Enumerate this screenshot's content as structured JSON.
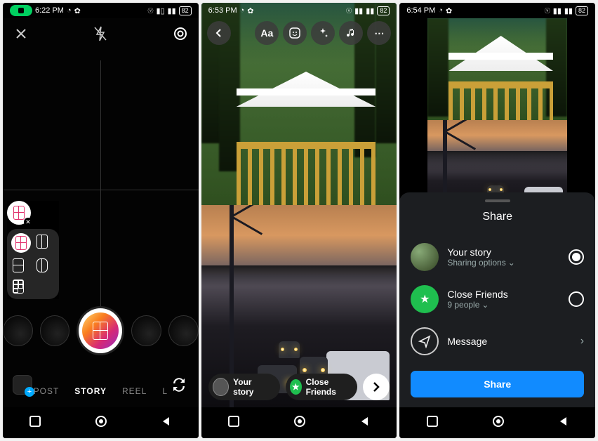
{
  "phone1": {
    "status": {
      "time": "6:22 PM",
      "battery": "82"
    },
    "modes": {
      "post": "POST",
      "story": "STORY",
      "reel": "REEL",
      "live": "L"
    },
    "layout_options": [
      "grid-2x2",
      "grid-1-2",
      "grid-2-1",
      "grid-1-1v",
      "grid-3x2"
    ]
  },
  "phone2": {
    "status": {
      "time": "6:53 PM",
      "battery": "82"
    },
    "tools": {
      "text": "Aa"
    },
    "bottom": {
      "your_story": "Your story",
      "close_friends": "Close Friends"
    }
  },
  "phone3": {
    "status": {
      "time": "6:54 PM",
      "battery": "82"
    },
    "sheet": {
      "title": "Share",
      "your_story": "Your story",
      "your_story_sub": "Sharing options",
      "close_friends": "Close Friends",
      "close_friends_sub": "9 people",
      "message": "Message",
      "share_btn": "Share"
    }
  }
}
